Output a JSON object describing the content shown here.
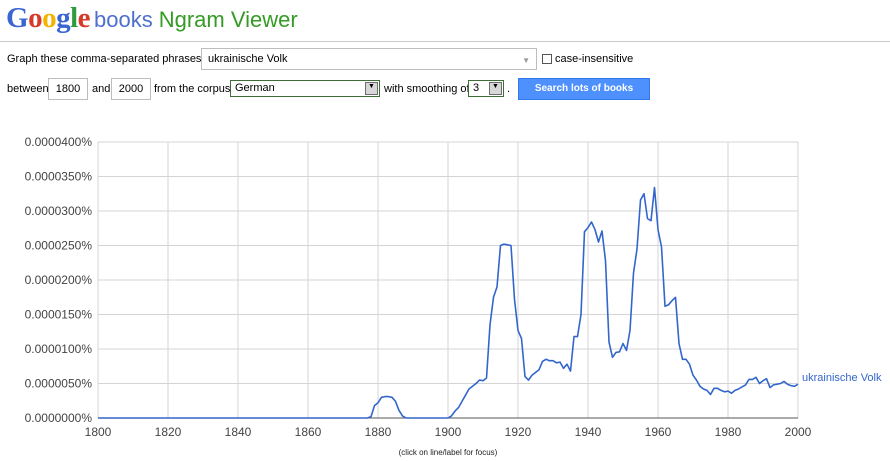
{
  "header": {
    "logo_letters": [
      "G",
      "o",
      "o",
      "g",
      "l",
      "e"
    ],
    "logo_colors": [
      "#3a66d2",
      "#d53a2b",
      "#f2b400",
      "#3a66d2",
      "#2e9b3d",
      "#d53a2b"
    ],
    "books_text": "books",
    "title": "Ngram Viewer"
  },
  "form": {
    "phrases_label": "Graph these comma-separated phrases:",
    "phrases_value": "ukrainische Volk",
    "case_insensitive_label": "case-insensitive",
    "between_label": "between",
    "year_start": "1800",
    "and_label": "and",
    "year_end": "2000",
    "corpus_label": "from the corpus",
    "corpus_value": "German",
    "smoothing_label": "with smoothing of",
    "smoothing_value": "3",
    "period": ".",
    "search_button": "Search lots of books"
  },
  "chart_data": {
    "type": "line",
    "xlim": [
      1800,
      2000
    ],
    "ylim": [
      0,
      4e-07
    ],
    "x_ticks": [
      1800,
      1820,
      1840,
      1860,
      1880,
      1900,
      1920,
      1940,
      1960,
      1980,
      2000
    ],
    "y_ticks": [
      0,
      5e-08,
      1e-07,
      1.5e-07,
      2e-07,
      2.5e-07,
      3e-07,
      3.5e-07,
      4e-07
    ],
    "x_tick_labels": [
      "1800",
      "1820",
      "1840",
      "1860",
      "1880",
      "1900",
      "1920",
      "1940",
      "1960",
      "1980",
      "2000"
    ],
    "y_tick_labels": [
      "0.0000000%",
      "0.0000050%",
      "0.0000100%",
      "0.0000150%",
      "0.0000200%",
      "0.0000250%",
      "0.0000300%",
      "0.0000350%",
      "0.0000400%"
    ],
    "grid": true,
    "footer_note": "(click on line/label for focus)",
    "series": [
      {
        "name": "ukrainische Volk",
        "color": "#3366cc",
        "points": [
          [
            1800,
            0
          ],
          [
            1870,
            0
          ],
          [
            1877,
            0
          ],
          [
            1878,
            2e-09
          ],
          [
            1879,
            1.8e-08
          ],
          [
            1880,
            2.2e-08
          ],
          [
            1881,
            3e-08
          ],
          [
            1882,
            3.1e-08
          ],
          [
            1883,
            3.1e-08
          ],
          [
            1884,
            3e-08
          ],
          [
            1885,
            2.4e-08
          ],
          [
            1886,
            1.1e-08
          ],
          [
            1887,
            3e-09
          ],
          [
            1888,
            0
          ],
          [
            1900,
            0
          ],
          [
            1901,
            3e-09
          ],
          [
            1902,
            1e-08
          ],
          [
            1903,
            1.5e-08
          ],
          [
            1904,
            2.4e-08
          ],
          [
            1905,
            3.3e-08
          ],
          [
            1906,
            4.2e-08
          ],
          [
            1907,
            4.6e-08
          ],
          [
            1908,
            5e-08
          ],
          [
            1909,
            5.5e-08
          ],
          [
            1910,
            5.4e-08
          ],
          [
            1911,
            5.8e-08
          ],
          [
            1912,
            1.35e-07
          ],
          [
            1913,
            1.75e-07
          ],
          [
            1914,
            1.9e-07
          ],
          [
            1915,
            2.5e-07
          ],
          [
            1916,
            2.52e-07
          ],
          [
            1917,
            2.51e-07
          ],
          [
            1918,
            2.5e-07
          ],
          [
            1919,
            1.72e-07
          ],
          [
            1920,
            1.27e-07
          ],
          [
            1921,
            1.15e-07
          ],
          [
            1922,
            6e-08
          ],
          [
            1923,
            5.5e-08
          ],
          [
            1924,
            6.2e-08
          ],
          [
            1925,
            6.6e-08
          ],
          [
            1926,
            7e-08
          ],
          [
            1927,
            8.2e-08
          ],
          [
            1928,
            8.5e-08
          ],
          [
            1929,
            8.3e-08
          ],
          [
            1930,
            8.3e-08
          ],
          [
            1931,
            8e-08
          ],
          [
            1932,
            8.1e-08
          ],
          [
            1933,
            7.2e-08
          ],
          [
            1934,
            7.8e-08
          ],
          [
            1935,
            6.8e-08
          ],
          [
            1936,
            1.18e-07
          ],
          [
            1937,
            1.18e-07
          ],
          [
            1938,
            1.5e-07
          ],
          [
            1939,
            2.7e-07
          ],
          [
            1940,
            2.76e-07
          ],
          [
            1941,
            2.84e-07
          ],
          [
            1942,
            2.73e-07
          ],
          [
            1943,
            2.55e-07
          ],
          [
            1944,
            2.71e-07
          ],
          [
            1945,
            2.28e-07
          ],
          [
            1946,
            1.1e-07
          ],
          [
            1947,
            8.8e-08
          ],
          [
            1948,
            9.5e-08
          ],
          [
            1949,
            9.6e-08
          ],
          [
            1950,
            1.08e-07
          ],
          [
            1951,
            9.8e-08
          ],
          [
            1952,
            1.27e-07
          ],
          [
            1953,
            2.1e-07
          ],
          [
            1954,
            2.45e-07
          ],
          [
            1955,
            3.16e-07
          ],
          [
            1956,
            3.25e-07
          ],
          [
            1957,
            2.89e-07
          ],
          [
            1958,
            2.86e-07
          ],
          [
            1959,
            3.34e-07
          ],
          [
            1960,
            2.73e-07
          ],
          [
            1961,
            2.48e-07
          ],
          [
            1962,
            1.62e-07
          ],
          [
            1963,
            1.64e-07
          ],
          [
            1964,
            1.7e-07
          ],
          [
            1965,
            1.75e-07
          ],
          [
            1966,
            1.08e-07
          ],
          [
            1967,
            8.5e-08
          ],
          [
            1968,
            8.5e-08
          ],
          [
            1969,
            7.8e-08
          ],
          [
            1970,
            6.2e-08
          ],
          [
            1971,
            5.5e-08
          ],
          [
            1972,
            4.6e-08
          ],
          [
            1973,
            4.2e-08
          ],
          [
            1974,
            4e-08
          ],
          [
            1975,
            3.4e-08
          ],
          [
            1976,
            4.3e-08
          ],
          [
            1977,
            4.3e-08
          ],
          [
            1978,
            4e-08
          ],
          [
            1979,
            3.8e-08
          ],
          [
            1980,
            3.9e-08
          ],
          [
            1981,
            3.6e-08
          ],
          [
            1982,
            4e-08
          ],
          [
            1983,
            4.2e-08
          ],
          [
            1984,
            4.5e-08
          ],
          [
            1985,
            4.8e-08
          ],
          [
            1986,
            5.6e-08
          ],
          [
            1987,
            5.6e-08
          ],
          [
            1988,
            5.9e-08
          ],
          [
            1989,
            5e-08
          ],
          [
            1990,
            5.4e-08
          ],
          [
            1991,
            5.7e-08
          ],
          [
            1992,
            4.4e-08
          ],
          [
            1993,
            4.8e-08
          ],
          [
            1994,
            4.9e-08
          ],
          [
            1995,
            5e-08
          ],
          [
            1996,
            5.3e-08
          ],
          [
            1997,
            4.9e-08
          ],
          [
            1998,
            4.7e-08
          ],
          [
            1999,
            4.6e-08
          ],
          [
            2000,
            4.9e-08
          ]
        ]
      }
    ]
  }
}
